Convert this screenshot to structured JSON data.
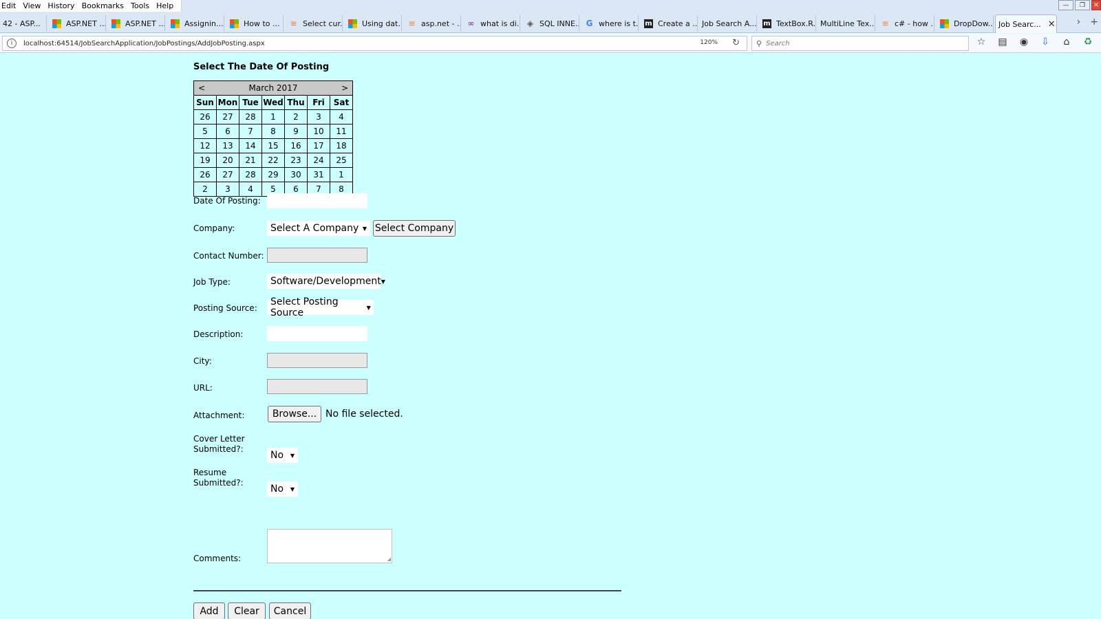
{
  "menu": [
    "Edit",
    "View",
    "History",
    "Bookmarks",
    "Tools",
    "Help"
  ],
  "tabs": [
    {
      "label": "42 - ASP...",
      "icon": "none"
    },
    {
      "label": "ASP.NET ...",
      "icon": "ms"
    },
    {
      "label": "ASP.NET ...",
      "icon": "ms"
    },
    {
      "label": "Assignin...",
      "icon": "ms"
    },
    {
      "label": "How to ...",
      "icon": "ms"
    },
    {
      "label": "Select cur...",
      "icon": "so"
    },
    {
      "label": "Using dat...",
      "icon": "ms"
    },
    {
      "label": "asp.net - ...",
      "icon": "so"
    },
    {
      "label": "what is di...",
      "icon": "vs"
    },
    {
      "label": "SQL INNE...",
      "icon": "sql"
    },
    {
      "label": "where is t...",
      "icon": "g"
    },
    {
      "label": "Create a ...",
      "icon": "m"
    },
    {
      "label": "Job Search A...",
      "icon": "none"
    },
    {
      "label": "TextBox.R...",
      "icon": "m"
    },
    {
      "label": "MultiLine Tex...",
      "icon": "none"
    },
    {
      "label": "c# - how ...",
      "icon": "so"
    },
    {
      "label": "DropDow...",
      "icon": "ms"
    },
    {
      "label": "Job Searc...",
      "icon": "none",
      "active": true
    }
  ],
  "address": {
    "url": "localhost:64514/JobSearchApplication/JobPostings/AddJobPosting.aspx",
    "zoom": "120%"
  },
  "search": {
    "placeholder": "Search"
  },
  "page": {
    "heading": "Select The Date Of Posting"
  },
  "calendar": {
    "prev": "<",
    "next": ">",
    "title": "March 2017",
    "weekdays": [
      "Sun",
      "Mon",
      "Tue",
      "Wed",
      "Thu",
      "Fri",
      "Sat"
    ],
    "weeks": [
      [
        "26",
        "27",
        "28",
        "1",
        "2",
        "3",
        "4"
      ],
      [
        "5",
        "6",
        "7",
        "8",
        "9",
        "10",
        "11"
      ],
      [
        "12",
        "13",
        "14",
        "15",
        "16",
        "17",
        "18"
      ],
      [
        "19",
        "20",
        "21",
        "22",
        "23",
        "24",
        "25"
      ],
      [
        "26",
        "27",
        "28",
        "29",
        "30",
        "31",
        "1"
      ],
      [
        "2",
        "3",
        "4",
        "5",
        "6",
        "7",
        "8"
      ]
    ]
  },
  "form": {
    "date_label": "Date Of Posting:",
    "date_value": "",
    "company_label": "Company:",
    "company_selected": "Select A Company",
    "select_company_button": "Select Company",
    "contact_label": "Contact Number:",
    "jobtype_label": "Job Type:",
    "jobtype_selected": "Software/Development",
    "source_label": "Posting Source:",
    "source_selected": "Select Posting Source",
    "description_label": "Description:",
    "city_label": "City:",
    "url_label": "URL:",
    "attachment_label": "Attachment:",
    "browse_button": "Browse...",
    "file_status": "No file selected.",
    "cover_label_1": "Cover Letter",
    "cover_label_2": "Submitted?:",
    "cover_selected": "No",
    "resume_label_1": "Resume",
    "resume_label_2": "Submitted?:",
    "resume_selected": "No",
    "comments_label": "Comments:"
  },
  "actions": {
    "add": "Add",
    "clear": "Clear",
    "cancel": "Cancel"
  }
}
